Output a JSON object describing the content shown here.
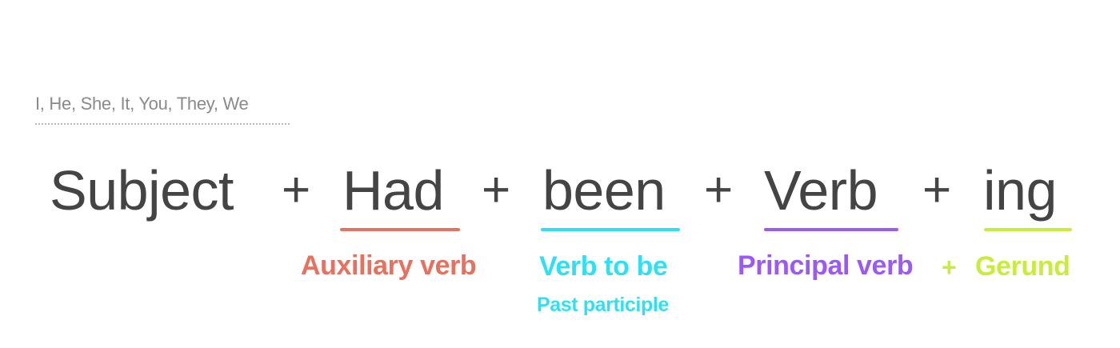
{
  "subject_pronouns": "I, He, She, It, You, They, We",
  "formula": {
    "subject": "Subject",
    "had": "Had",
    "been": "been",
    "verb": "Verb",
    "ing": "ing",
    "plus": "+"
  },
  "labels": {
    "auxiliary": "Auxiliary verb",
    "verb_to_be": "Verb to be",
    "past_participle": "Past participle",
    "principal": "Principal verb",
    "label_plus": "+",
    "gerund": "Gerund"
  },
  "colors": {
    "auxiliary": "#e8705f",
    "verb_to_be": "#2fe0f5",
    "principal": "#9b59f5",
    "gerund": "#c8ec3a",
    "text": "#444444",
    "pronouns": "#8a8a8a"
  }
}
